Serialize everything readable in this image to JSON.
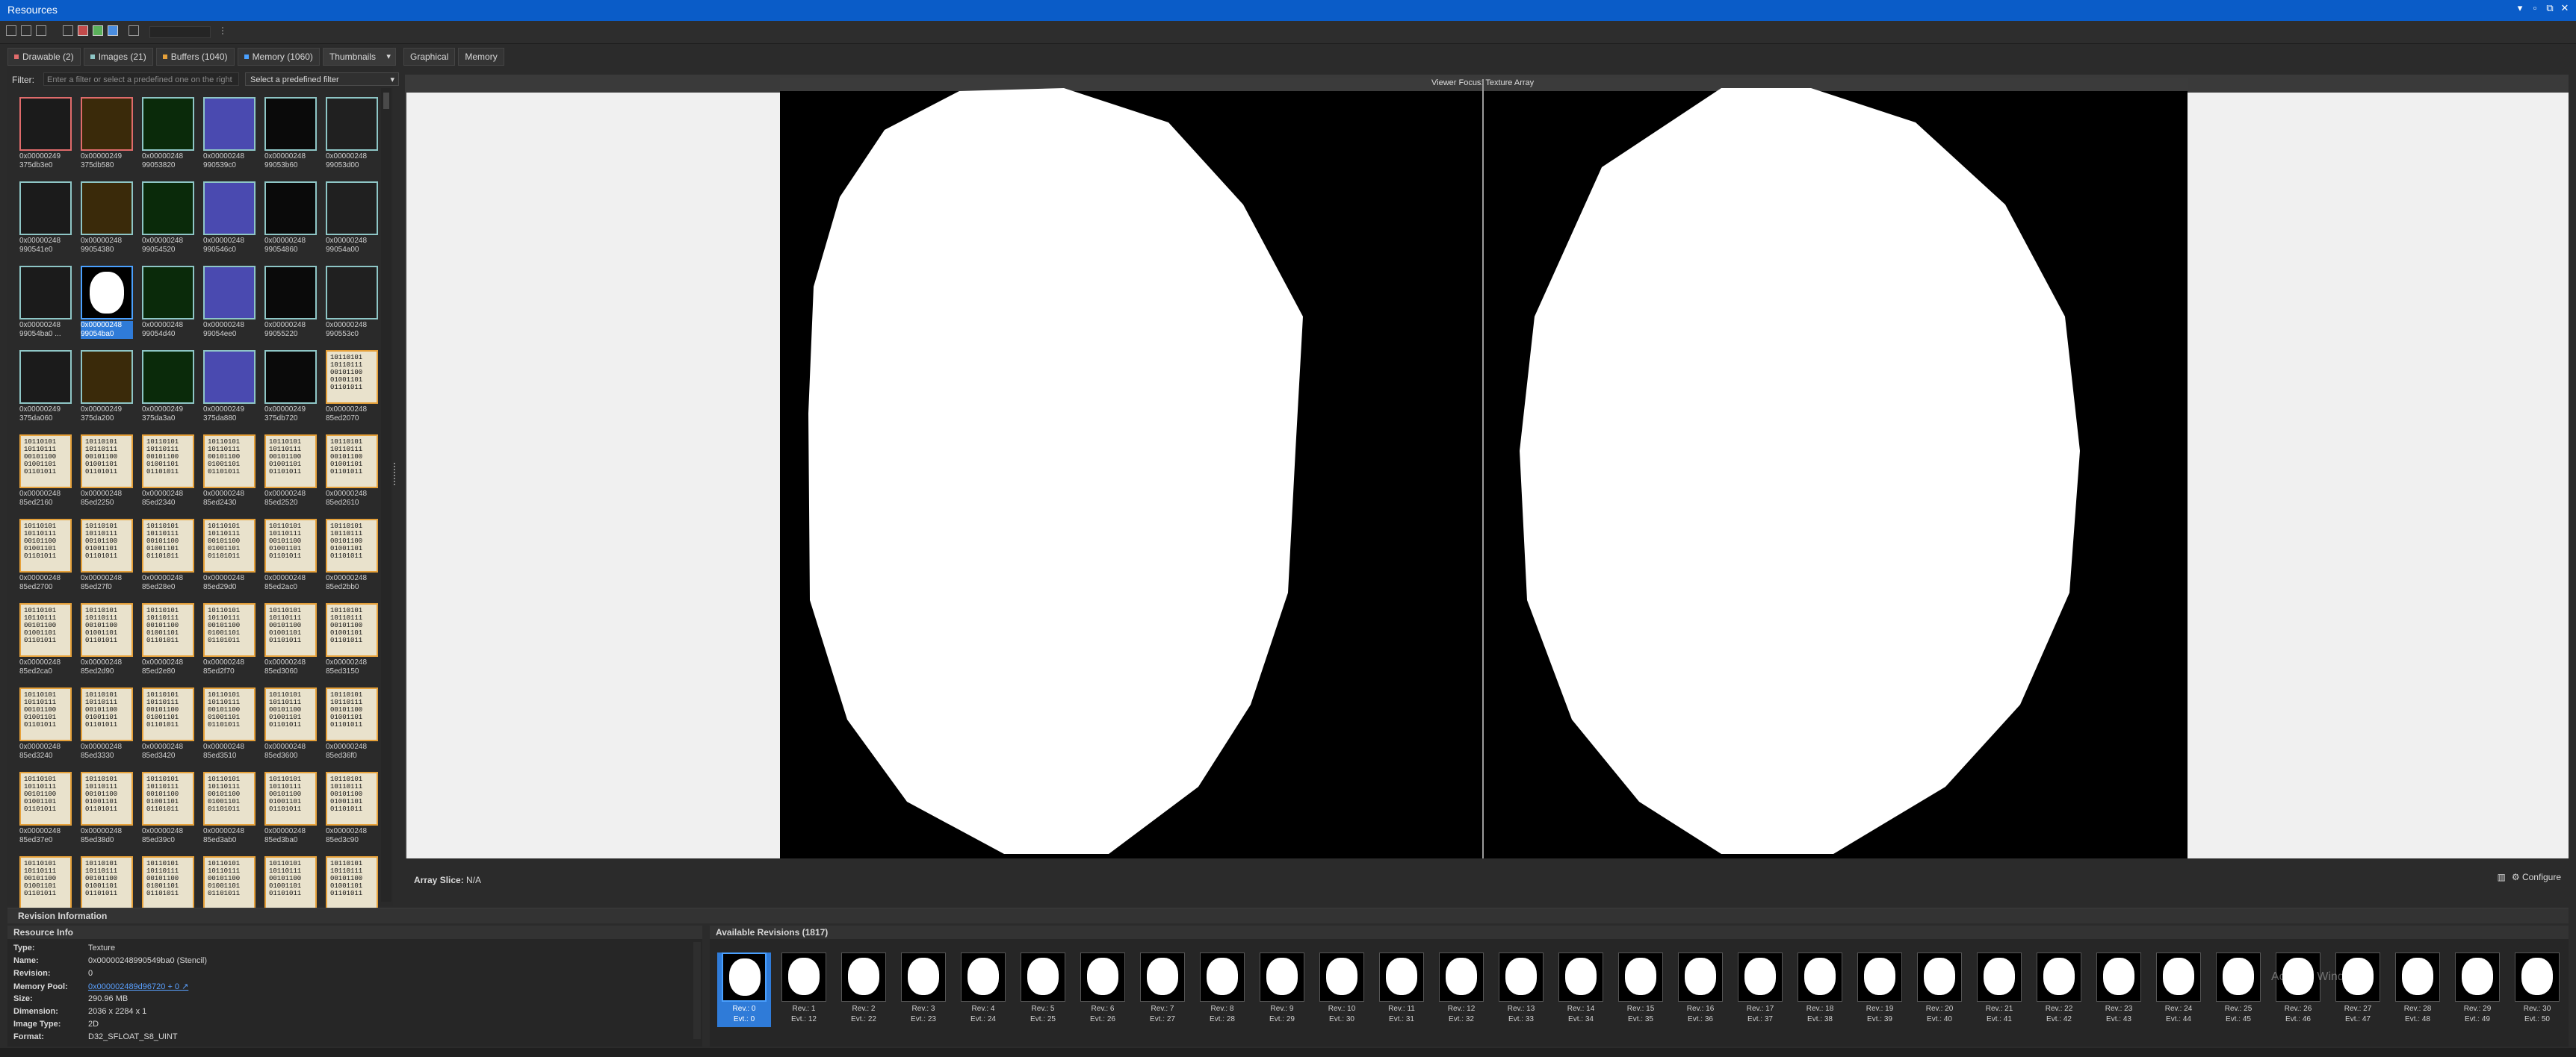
{
  "window": {
    "title": "Resources",
    "controls": [
      "▾",
      "▫",
      "⧉",
      "✕"
    ]
  },
  "tabs": {
    "drawable": "Drawable (2)",
    "images": "Images (21)",
    "buffers": "Buffers (1040)",
    "memory": "Memory (1060)",
    "view_mode": "Thumbnails"
  },
  "filter": {
    "label": "Filter:",
    "placeholder": "Enter a filter or select a predefined one on the right",
    "predefined": "Select a predefined filter"
  },
  "thumbnails": [
    {
      "l1": "0x00000249",
      "l2": "375db3e0",
      "kind": "red"
    },
    {
      "l1": "0x00000249",
      "l2": "375db580",
      "kind": "red"
    },
    {
      "l1": "0x00000248",
      "l2": "99053820",
      "kind": "teal"
    },
    {
      "l1": "0x00000248",
      "l2": "990539c0",
      "kind": "teal"
    },
    {
      "l1": "0x00000248",
      "l2": "99053b60",
      "kind": "teal"
    },
    {
      "l1": "0x00000248",
      "l2": "99053d00",
      "kind": "teal"
    },
    {
      "l1": "0x00000248",
      "l2": "990541e0",
      "kind": "teal"
    },
    {
      "l1": "0x00000248",
      "l2": "99054380",
      "kind": "teal"
    },
    {
      "l1": "0x00000248",
      "l2": "99054520",
      "kind": "teal"
    },
    {
      "l1": "0x00000248",
      "l2": "990546c0",
      "kind": "teal"
    },
    {
      "l1": "0x00000248",
      "l2": "99054860",
      "kind": "teal"
    },
    {
      "l1": "0x00000248",
      "l2": "99054a00",
      "kind": "teal"
    },
    {
      "l1": "0x00000248",
      "l2": "99054ba0 ...",
      "kind": "teal"
    },
    {
      "l1": "0x00000248",
      "l2": "99054ba0",
      "kind": "sel"
    },
    {
      "l1": "0x00000248",
      "l2": "99054d40",
      "kind": "teal"
    },
    {
      "l1": "0x00000248",
      "l2": "99054ee0",
      "kind": "teal"
    },
    {
      "l1": "0x00000248",
      "l2": "99055220",
      "kind": "teal"
    },
    {
      "l1": "0x00000248",
      "l2": "990553c0",
      "kind": "teal"
    },
    {
      "l1": "0x00000249",
      "l2": "375da060",
      "kind": "teal"
    },
    {
      "l1": "0x00000249",
      "l2": "375da200",
      "kind": "teal"
    },
    {
      "l1": "0x00000249",
      "l2": "375da3a0",
      "kind": "teal"
    },
    {
      "l1": "0x00000249",
      "l2": "375da880",
      "kind": "teal"
    },
    {
      "l1": "0x00000249",
      "l2": "375db720",
      "kind": "teal"
    },
    {
      "l1": "0x00000248",
      "l2": "85ed2070",
      "kind": "gold"
    },
    {
      "l1": "0x00000248",
      "l2": "85ed2160",
      "kind": "gold"
    },
    {
      "l1": "0x00000248",
      "l2": "85ed2250",
      "kind": "gold"
    },
    {
      "l1": "0x00000248",
      "l2": "85ed2340",
      "kind": "gold"
    },
    {
      "l1": "0x00000248",
      "l2": "85ed2430",
      "kind": "gold"
    },
    {
      "l1": "0x00000248",
      "l2": "85ed2520",
      "kind": "gold"
    },
    {
      "l1": "0x00000248",
      "l2": "85ed2610",
      "kind": "gold"
    },
    {
      "l1": "0x00000248",
      "l2": "85ed2700",
      "kind": "gold"
    },
    {
      "l1": "0x00000248",
      "l2": "85ed27f0",
      "kind": "gold"
    },
    {
      "l1": "0x00000248",
      "l2": "85ed28e0",
      "kind": "gold"
    },
    {
      "l1": "0x00000248",
      "l2": "85ed29d0",
      "kind": "gold"
    },
    {
      "l1": "0x00000248",
      "l2": "85ed2ac0",
      "kind": "gold"
    },
    {
      "l1": "0x00000248",
      "l2": "85ed2bb0",
      "kind": "gold"
    },
    {
      "l1": "0x00000248",
      "l2": "85ed2ca0",
      "kind": "gold"
    },
    {
      "l1": "0x00000248",
      "l2": "85ed2d90",
      "kind": "gold"
    },
    {
      "l1": "0x00000248",
      "l2": "85ed2e80",
      "kind": "gold"
    },
    {
      "l1": "0x00000248",
      "l2": "85ed2f70",
      "kind": "gold"
    },
    {
      "l1": "0x00000248",
      "l2": "85ed3060",
      "kind": "gold"
    },
    {
      "l1": "0x00000248",
      "l2": "85ed3150",
      "kind": "gold"
    },
    {
      "l1": "0x00000248",
      "l2": "85ed3240",
      "kind": "gold"
    },
    {
      "l1": "0x00000248",
      "l2": "85ed3330",
      "kind": "gold"
    },
    {
      "l1": "0x00000248",
      "l2": "85ed3420",
      "kind": "gold"
    },
    {
      "l1": "0x00000248",
      "l2": "85ed3510",
      "kind": "gold"
    },
    {
      "l1": "0x00000248",
      "l2": "85ed3600",
      "kind": "gold"
    },
    {
      "l1": "0x00000248",
      "l2": "85ed36f0",
      "kind": "gold"
    },
    {
      "l1": "0x00000248",
      "l2": "85ed37e0",
      "kind": "gold"
    },
    {
      "l1": "0x00000248",
      "l2": "85ed38d0",
      "kind": "gold"
    },
    {
      "l1": "0x00000248",
      "l2": "85ed39c0",
      "kind": "gold"
    },
    {
      "l1": "0x00000248",
      "l2": "85ed3ab0",
      "kind": "gold"
    },
    {
      "l1": "0x00000248",
      "l2": "85ed3ba0",
      "kind": "gold"
    },
    {
      "l1": "0x00000248",
      "l2": "85ed3c90",
      "kind": "gold"
    },
    {
      "l1": "",
      "l2": "",
      "kind": "gold"
    },
    {
      "l1": "",
      "l2": "",
      "kind": "gold"
    },
    {
      "l1": "",
      "l2": "",
      "kind": "gold"
    },
    {
      "l1": "",
      "l2": "",
      "kind": "gold"
    },
    {
      "l1": "",
      "l2": "",
      "kind": "gold"
    },
    {
      "l1": "",
      "l2": "",
      "kind": "gold"
    }
  ],
  "bits_text": "10110101\n10110111\n00101100\n01001101\n01101011",
  "viewer": {
    "tabs": [
      "Graphical",
      "Memory"
    ],
    "focus": "Viewer Focus: Texture Array",
    "array_slice_label": "Array Slice:",
    "array_slice_value": "N/A",
    "configure": "Configure"
  },
  "revision_section": "Revision Information",
  "resource_info": {
    "title": "Resource Info",
    "rows": [
      {
        "k": "Type:",
        "v": "Texture"
      },
      {
        "k": "Name:",
        "v": "0x00000248990549ba0 (Stencil)"
      },
      {
        "k": "Revision:",
        "v": "0"
      },
      {
        "k": "Memory Pool:",
        "v": "0x000002489d96720 + 0 ↗",
        "link": true
      },
      {
        "k": "Size:",
        "v": "290.96 MB"
      },
      {
        "k": "Dimension:",
        "v": "2036 x 2284 x 1"
      },
      {
        "k": "Image Type:",
        "v": "2D"
      },
      {
        "k": "Format:",
        "v": "D32_SFLOAT_S8_UINT"
      }
    ]
  },
  "available_revisions": {
    "title": "Available Revisions (1817)",
    "items": [
      {
        "rev": "Rev.: 0",
        "evt": "Evt.: 0"
      },
      {
        "rev": "Rev.: 1",
        "evt": "Evt.: 12"
      },
      {
        "rev": "Rev.: 2",
        "evt": "Evt.: 22"
      },
      {
        "rev": "Rev.: 3",
        "evt": "Evt.: 23"
      },
      {
        "rev": "Rev.: 4",
        "evt": "Evt.: 24"
      },
      {
        "rev": "Rev.: 5",
        "evt": "Evt.: 25"
      },
      {
        "rev": "Rev.: 6",
        "evt": "Evt.: 26"
      },
      {
        "rev": "Rev.: 7",
        "evt": "Evt.: 27"
      },
      {
        "rev": "Rev.: 8",
        "evt": "Evt.: 28"
      },
      {
        "rev": "Rev.: 9",
        "evt": "Evt.: 29"
      },
      {
        "rev": "Rev.: 10",
        "evt": "Evt.: 30"
      },
      {
        "rev": "Rev.: 11",
        "evt": "Evt.: 31"
      },
      {
        "rev": "Rev.: 12",
        "evt": "Evt.: 32"
      },
      {
        "rev": "Rev.: 13",
        "evt": "Evt.: 33"
      },
      {
        "rev": "Rev.: 14",
        "evt": "Evt.: 34"
      },
      {
        "rev": "Rev.: 15",
        "evt": "Evt.: 35"
      },
      {
        "rev": "Rev.: 16",
        "evt": "Evt.: 36"
      },
      {
        "rev": "Rev.: 17",
        "evt": "Evt.: 37"
      },
      {
        "rev": "Rev.: 18",
        "evt": "Evt.: 38"
      },
      {
        "rev": "Rev.: 19",
        "evt": "Evt.: 39"
      },
      {
        "rev": "Rev.: 20",
        "evt": "Evt.: 40"
      },
      {
        "rev": "Rev.: 21",
        "evt": "Evt.: 41"
      },
      {
        "rev": "Rev.: 22",
        "evt": "Evt.: 42"
      },
      {
        "rev": "Rev.: 23",
        "evt": "Evt.: 43"
      },
      {
        "rev": "Rev.: 24",
        "evt": "Evt.: 44"
      },
      {
        "rev": "Rev.: 25",
        "evt": "Evt.: 45"
      },
      {
        "rev": "Rev.: 26",
        "evt": "Evt.: 46"
      },
      {
        "rev": "Rev.: 27",
        "evt": "Evt.: 47"
      },
      {
        "rev": "Rev.: 28",
        "evt": "Evt.: 48"
      },
      {
        "rev": "Rev.: 29",
        "evt": "Evt.: 49"
      },
      {
        "rev": "Rev.: 30",
        "evt": "Evt.: 50"
      }
    ]
  },
  "watermark": "Activate Windows"
}
